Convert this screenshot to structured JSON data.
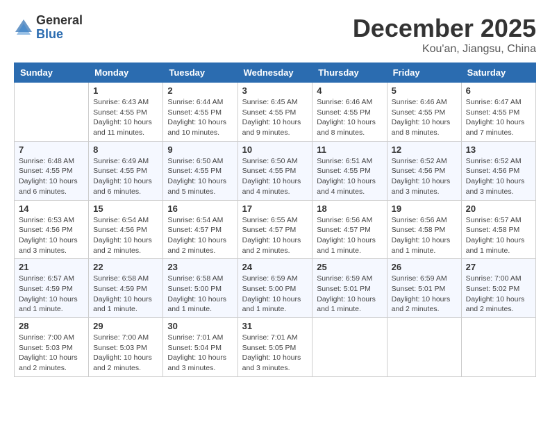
{
  "header": {
    "logo_general": "General",
    "logo_blue": "Blue",
    "title": "December 2025",
    "location": "Kou'an, Jiangsu, China"
  },
  "weekdays": [
    "Sunday",
    "Monday",
    "Tuesday",
    "Wednesday",
    "Thursday",
    "Friday",
    "Saturday"
  ],
  "weeks": [
    [
      {
        "day": "",
        "info": ""
      },
      {
        "day": "1",
        "info": "Sunrise: 6:43 AM\nSunset: 4:55 PM\nDaylight: 10 hours\nand 11 minutes."
      },
      {
        "day": "2",
        "info": "Sunrise: 6:44 AM\nSunset: 4:55 PM\nDaylight: 10 hours\nand 10 minutes."
      },
      {
        "day": "3",
        "info": "Sunrise: 6:45 AM\nSunset: 4:55 PM\nDaylight: 10 hours\nand 9 minutes."
      },
      {
        "day": "4",
        "info": "Sunrise: 6:46 AM\nSunset: 4:55 PM\nDaylight: 10 hours\nand 8 minutes."
      },
      {
        "day": "5",
        "info": "Sunrise: 6:46 AM\nSunset: 4:55 PM\nDaylight: 10 hours\nand 8 minutes."
      },
      {
        "day": "6",
        "info": "Sunrise: 6:47 AM\nSunset: 4:55 PM\nDaylight: 10 hours\nand 7 minutes."
      }
    ],
    [
      {
        "day": "7",
        "info": "Sunrise: 6:48 AM\nSunset: 4:55 PM\nDaylight: 10 hours\nand 6 minutes."
      },
      {
        "day": "8",
        "info": "Sunrise: 6:49 AM\nSunset: 4:55 PM\nDaylight: 10 hours\nand 6 minutes."
      },
      {
        "day": "9",
        "info": "Sunrise: 6:50 AM\nSunset: 4:55 PM\nDaylight: 10 hours\nand 5 minutes."
      },
      {
        "day": "10",
        "info": "Sunrise: 6:50 AM\nSunset: 4:55 PM\nDaylight: 10 hours\nand 4 minutes."
      },
      {
        "day": "11",
        "info": "Sunrise: 6:51 AM\nSunset: 4:55 PM\nDaylight: 10 hours\nand 4 minutes."
      },
      {
        "day": "12",
        "info": "Sunrise: 6:52 AM\nSunset: 4:56 PM\nDaylight: 10 hours\nand 3 minutes."
      },
      {
        "day": "13",
        "info": "Sunrise: 6:52 AM\nSunset: 4:56 PM\nDaylight: 10 hours\nand 3 minutes."
      }
    ],
    [
      {
        "day": "14",
        "info": "Sunrise: 6:53 AM\nSunset: 4:56 PM\nDaylight: 10 hours\nand 3 minutes."
      },
      {
        "day": "15",
        "info": "Sunrise: 6:54 AM\nSunset: 4:56 PM\nDaylight: 10 hours\nand 2 minutes."
      },
      {
        "day": "16",
        "info": "Sunrise: 6:54 AM\nSunset: 4:57 PM\nDaylight: 10 hours\nand 2 minutes."
      },
      {
        "day": "17",
        "info": "Sunrise: 6:55 AM\nSunset: 4:57 PM\nDaylight: 10 hours\nand 2 minutes."
      },
      {
        "day": "18",
        "info": "Sunrise: 6:56 AM\nSunset: 4:57 PM\nDaylight: 10 hours\nand 1 minute."
      },
      {
        "day": "19",
        "info": "Sunrise: 6:56 AM\nSunset: 4:58 PM\nDaylight: 10 hours\nand 1 minute."
      },
      {
        "day": "20",
        "info": "Sunrise: 6:57 AM\nSunset: 4:58 PM\nDaylight: 10 hours\nand 1 minute."
      }
    ],
    [
      {
        "day": "21",
        "info": "Sunrise: 6:57 AM\nSunset: 4:59 PM\nDaylight: 10 hours\nand 1 minute."
      },
      {
        "day": "22",
        "info": "Sunrise: 6:58 AM\nSunset: 4:59 PM\nDaylight: 10 hours\nand 1 minute."
      },
      {
        "day": "23",
        "info": "Sunrise: 6:58 AM\nSunset: 5:00 PM\nDaylight: 10 hours\nand 1 minute."
      },
      {
        "day": "24",
        "info": "Sunrise: 6:59 AM\nSunset: 5:00 PM\nDaylight: 10 hours\nand 1 minute."
      },
      {
        "day": "25",
        "info": "Sunrise: 6:59 AM\nSunset: 5:01 PM\nDaylight: 10 hours\nand 1 minute."
      },
      {
        "day": "26",
        "info": "Sunrise: 6:59 AM\nSunset: 5:01 PM\nDaylight: 10 hours\nand 2 minutes."
      },
      {
        "day": "27",
        "info": "Sunrise: 7:00 AM\nSunset: 5:02 PM\nDaylight: 10 hours\nand 2 minutes."
      }
    ],
    [
      {
        "day": "28",
        "info": "Sunrise: 7:00 AM\nSunset: 5:03 PM\nDaylight: 10 hours\nand 2 minutes."
      },
      {
        "day": "29",
        "info": "Sunrise: 7:00 AM\nSunset: 5:03 PM\nDaylight: 10 hours\nand 2 minutes."
      },
      {
        "day": "30",
        "info": "Sunrise: 7:01 AM\nSunset: 5:04 PM\nDaylight: 10 hours\nand 3 minutes."
      },
      {
        "day": "31",
        "info": "Sunrise: 7:01 AM\nSunset: 5:05 PM\nDaylight: 10 hours\nand 3 minutes."
      },
      {
        "day": "",
        "info": ""
      },
      {
        "day": "",
        "info": ""
      },
      {
        "day": "",
        "info": ""
      }
    ]
  ]
}
